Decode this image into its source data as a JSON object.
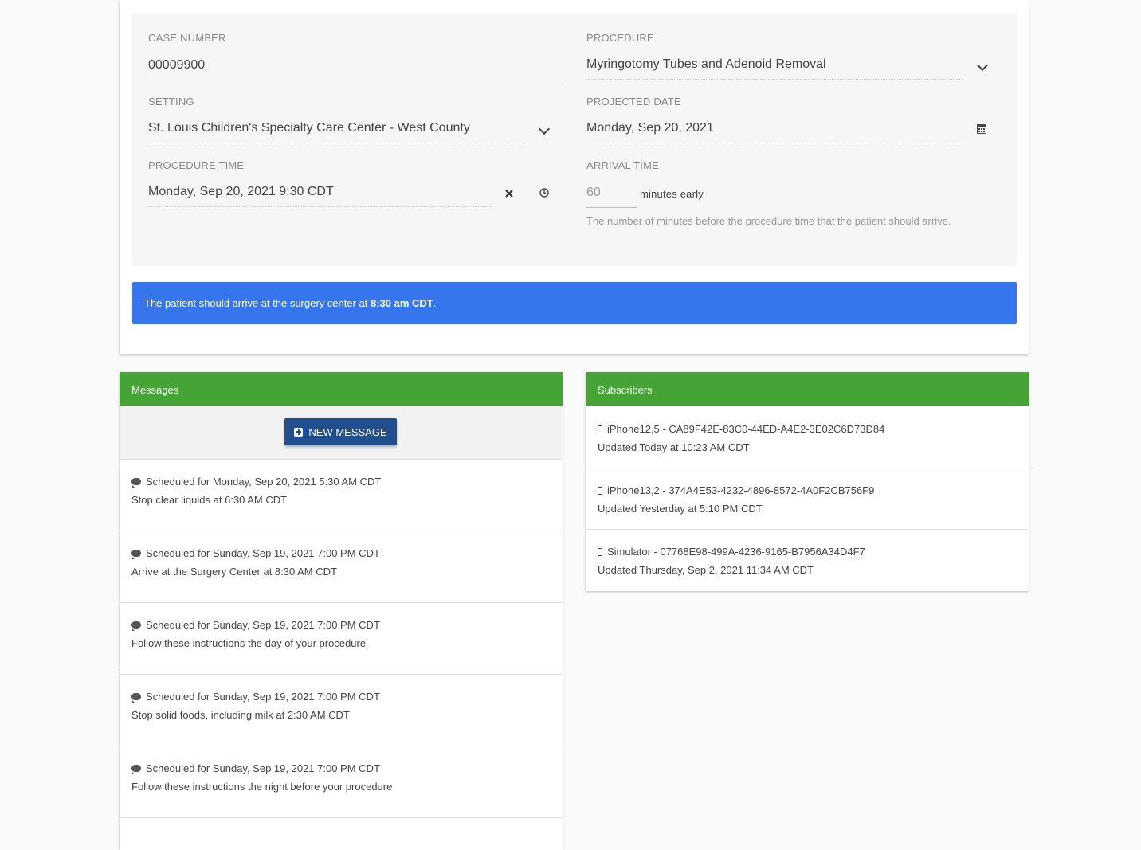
{
  "form": {
    "case_number_label": "CASE NUMBER",
    "case_number_value": "00009900",
    "procedure_label": "PROCEDURE",
    "procedure_value": "Myringotomy Tubes and Adenoid Removal",
    "setting_label": "SETTING",
    "setting_value": "St. Louis Children's Specialty Care Center - West County",
    "projected_date_label": "PROJECTED DATE",
    "projected_date_value": "Monday, Sep 20, 2021",
    "procedure_time_label": "PROCEDURE TIME",
    "procedure_time_value": "Monday, Sep 20, 2021 9:30 CDT",
    "arrival_time_label": "ARRIVAL TIME",
    "arrival_time_value": "60",
    "arrival_time_suffix": "minutes early",
    "arrival_time_hint": "The number of minutes before the procedure time that the patient should arrive."
  },
  "alert": {
    "prefix": "The patient should arrive at the surgery center at ",
    "time": "8:30 am CDT",
    "suffix": ".",
    "color": "#3676ec"
  },
  "messages": {
    "title": "Messages",
    "new_button": "NEW MESSAGE",
    "items": [
      {
        "scheduled": "Scheduled for Monday, Sep 20, 2021 5:30 AM CDT",
        "text": "Stop clear liquids at 6:30 AM CDT"
      },
      {
        "scheduled": "Scheduled for Sunday, Sep 19, 2021 7:00 PM CDT",
        "text": "Arrive at the Surgery Center at 8:30 AM CDT"
      },
      {
        "scheduled": "Scheduled for Sunday, Sep 19, 2021 7:00 PM CDT",
        "text": "Follow these instructions the day of your procedure"
      },
      {
        "scheduled": "Scheduled for Sunday, Sep 19, 2021 7:00 PM CDT",
        "text": "Stop solid foods, including milk at 2:30 AM CDT"
      },
      {
        "scheduled": "Scheduled for Sunday, Sep 19, 2021 7:00 PM CDT",
        "text": "Follow these instructions the night before your procedure"
      }
    ]
  },
  "subscribers": {
    "title": "Subscribers",
    "items": [
      {
        "device": "iPhone12,5 - CA89F42E-83C0-44ED-A4E2-3E02C6D73D84",
        "updated": "Updated Today at 10:23 AM CDT"
      },
      {
        "device": "iPhone13,2 - 374A4E53-4232-4896-8572-4A0F2CB756F9",
        "updated": "Updated Yesterday at 5:10 PM CDT"
      },
      {
        "device": "Simulator - 07768E98-499A-4236-9165-B7956A34D4F7",
        "updated": "Updated Thursday, Sep 2, 2021 11:34 AM CDT"
      }
    ]
  },
  "colors": {
    "header_green": "#46a436",
    "button_blue": "#1f4f8f"
  }
}
